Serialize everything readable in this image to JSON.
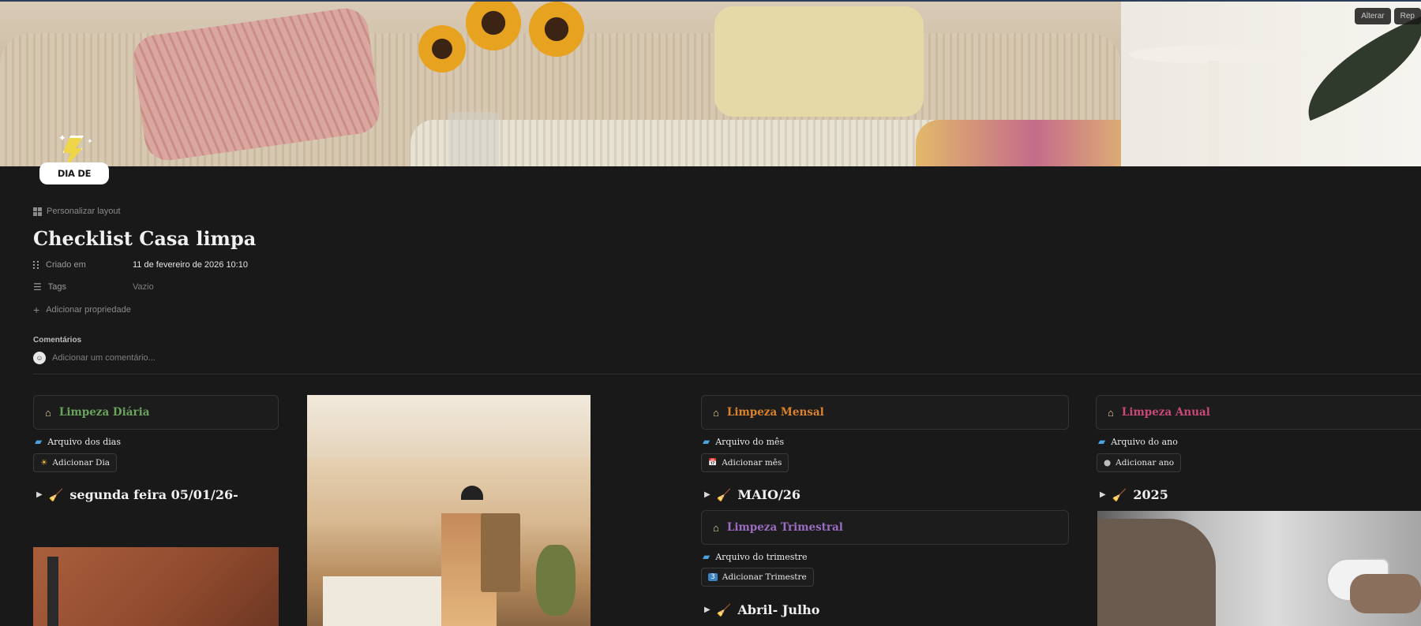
{
  "cover": {
    "change_label": "Alterar",
    "reposition_label": "Rep"
  },
  "logo": {
    "text": "DIA DE FAXINA"
  },
  "page": {
    "personalize_label": "Personalizar layout",
    "title": "Checklist Casa limpa",
    "properties": [
      {
        "name": "Criado em",
        "value": "11 de fevereiro de 2026 10:10"
      },
      {
        "name": "Tags",
        "value": "Vazio"
      }
    ],
    "add_property_label": "Adicionar propriedade",
    "comments_label": "Comentários",
    "comment_placeholder": "Adicionar um comentário...",
    "avatar_glyph": "☺"
  },
  "sections": {
    "diaria": {
      "title": "Limpeza Diária",
      "color": "#6aa35d",
      "archive_label": "Arquivo dos dias",
      "add_label": "Adicionar Dia",
      "add_icon": "☀",
      "toggle_label": "segunda feira 05/01/26-"
    },
    "mensal": {
      "title": "Limpeza Mensal",
      "color": "#d9822b",
      "archive_label": "Arquivo do mês",
      "add_label": "Adicionar mês",
      "add_icon": "📅",
      "toggle_label": "MAIO/26"
    },
    "trimestral": {
      "title": "Limpeza Trimestral",
      "color": "#9b6cc2",
      "archive_label": "Arquivo do trimestre",
      "add_label": "Adicionar Trimestre",
      "add_icon": "3",
      "toggle_label": "Abril- Julho"
    },
    "anual": {
      "title": "Limpeza Anual",
      "color": "#c9487a",
      "archive_label": "Arquivo do ano",
      "add_label": "Adicionar ano",
      "add_icon": "●",
      "toggle_label": "2025"
    }
  },
  "icons": {
    "house": "house-icon",
    "folder": "folder-icon",
    "broom": "broom-icon",
    "toggle": "triangle-right-icon"
  }
}
